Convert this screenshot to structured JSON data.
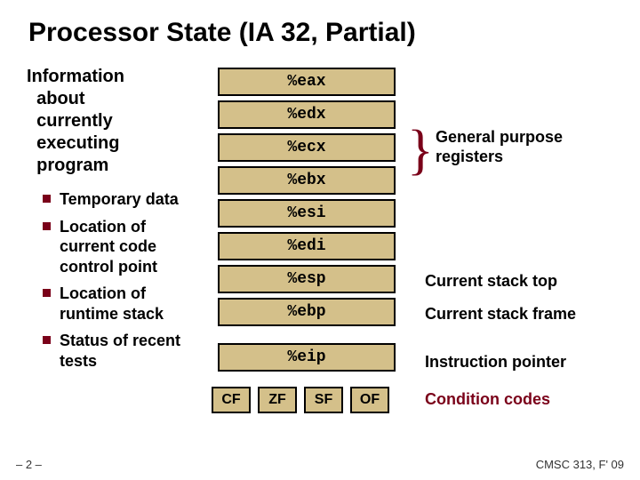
{
  "title": "Processor State (IA 32, Partial)",
  "heading": {
    "l1": "Information",
    "l2": "about",
    "l3": "currently",
    "l4": "executing",
    "l5": "program"
  },
  "bullets": [
    "Temporary data",
    "Location of current code control point",
    "Location of runtime stack",
    "Status of recent tests"
  ],
  "registers": {
    "eax": "%eax",
    "edx": "%edx",
    "ecx": "%ecx",
    "ebx": "%ebx",
    "esi": "%esi",
    "edi": "%edi",
    "esp": "%esp",
    "ebp": "%ebp",
    "eip": "%eip"
  },
  "flags": {
    "cf": "CF",
    "zf": "ZF",
    "sf": "SF",
    "of": "OF"
  },
  "labels": {
    "general": "General purpose registers",
    "stack_top": "Current stack top",
    "stack_frame": "Current stack frame",
    "ip": "Instruction pointer",
    "cc": "Condition codes"
  },
  "pagenum": "– 2 –",
  "footer": "CMSC 313, F' 09"
}
